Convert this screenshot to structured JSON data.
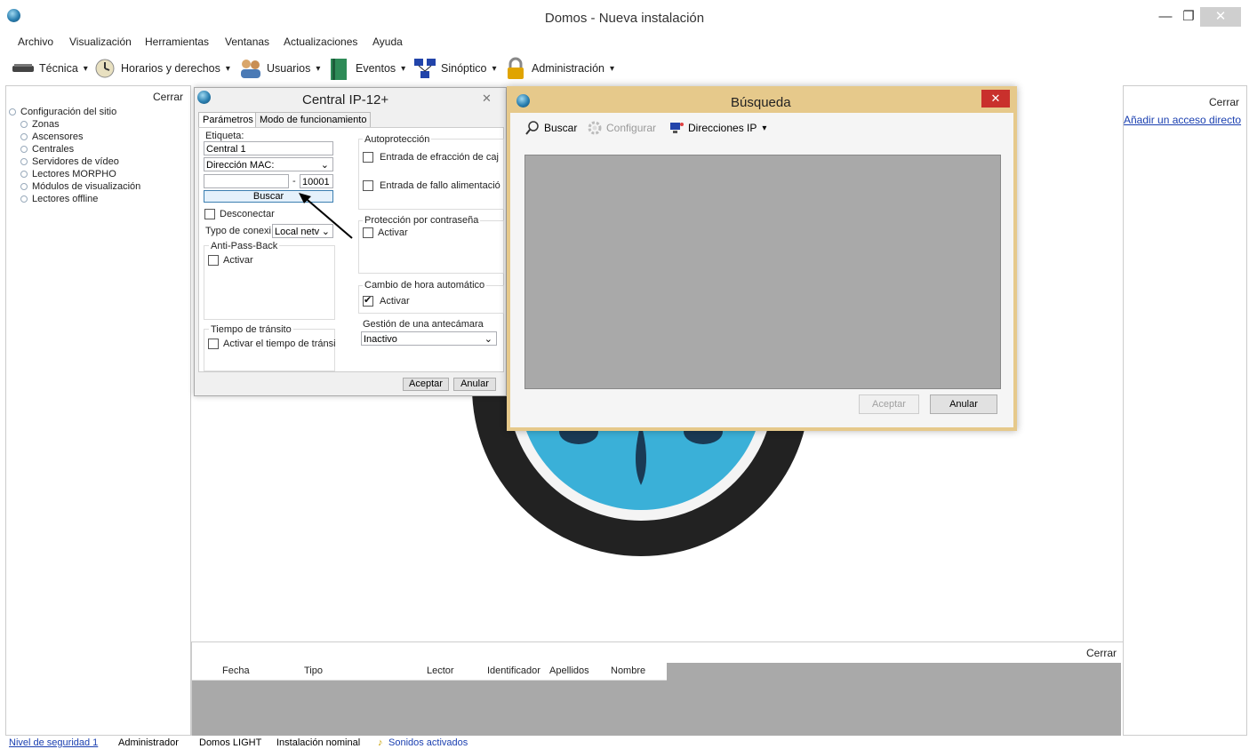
{
  "window": {
    "title": "Domos - Nueva instalación",
    "minimize": "—",
    "restore": "❐",
    "close": "✕"
  },
  "menu": [
    "Archivo",
    "Visualización",
    "Herramientas",
    "Ventanas",
    "Actualizaciones",
    "Ayuda"
  ],
  "toolbar": [
    {
      "label": "Técnica",
      "icon": "chip-icon"
    },
    {
      "label": "Horarios y derechos",
      "icon": "clock-icon"
    },
    {
      "label": "Usuarios",
      "icon": "users-icon"
    },
    {
      "label": "Eventos",
      "icon": "book-icon"
    },
    {
      "label": "Sinóptico",
      "icon": "network-icon"
    },
    {
      "label": "Administración",
      "icon": "lock-icon"
    }
  ],
  "left_panel": {
    "close": "Cerrar",
    "root": "Configuración del sitio",
    "items": [
      "Zonas",
      "Ascensores",
      "Centrales",
      "Servidores de vídeo",
      "Lectores MORPHO",
      "Módulos de visualización",
      "Lectores offline"
    ]
  },
  "right_panel": {
    "close": "Cerrar",
    "shortcut_link": "Añadir un acceso directo"
  },
  "central_dialog": {
    "title": "Central IP-12+",
    "tabs": [
      "Parámetros",
      "Modo de funcionamiento"
    ],
    "etiqueta_label": "Etiqueta:",
    "etiqueta_value": "Central 1",
    "mac_select": "Dirección MAC:",
    "port_sep": "-",
    "port_value": "10001",
    "buscar_button": "Buscar",
    "desconectar": "Desconectar",
    "typo_label": "Typo de conexi",
    "typo_value": "Local netv",
    "antipass_title": "Anti-Pass-Back",
    "antipass_activar": "Activar",
    "transito_title": "Tiempo de tránsito",
    "transito_activar": "Activar el tiempo de tránsi",
    "autoproteccion_title": "Autoprotección",
    "autoproteccion_items": [
      "Entrada de efracción de caj",
      "Entrada de fallo alimentació"
    ],
    "password_title": "Protección por contraseña",
    "password_activar": "Activar",
    "cambio_title": "Cambio de hora automático",
    "cambio_activar": "Activar",
    "gestion_title": "Gestión de una antecámara",
    "gestion_value": "Inactivo",
    "aceptar": "Aceptar",
    "anular": "Anular"
  },
  "busqueda_dialog": {
    "title": "Búsqueda",
    "buscar": "Buscar",
    "configurar": "Configurar",
    "direcciones": "Direcciones IP",
    "aceptar": "Aceptar",
    "anular": "Anular"
  },
  "bottom_panel": {
    "close": "Cerrar",
    "columns": [
      "Fecha",
      "Tipo",
      "Lector",
      "Identificador",
      "Apellidos",
      "Nombre"
    ]
  },
  "status_bar": [
    "Nivel de seguridad 1",
    "Administrador",
    "Domos LIGHT",
    "Instalación nominal",
    "Sonidos activados"
  ],
  "colors": {
    "link": "#1a3fb0",
    "close_red": "#c9302c",
    "busqueda_border": "#e6c98b",
    "grid_gray": "#a9a9a9"
  }
}
